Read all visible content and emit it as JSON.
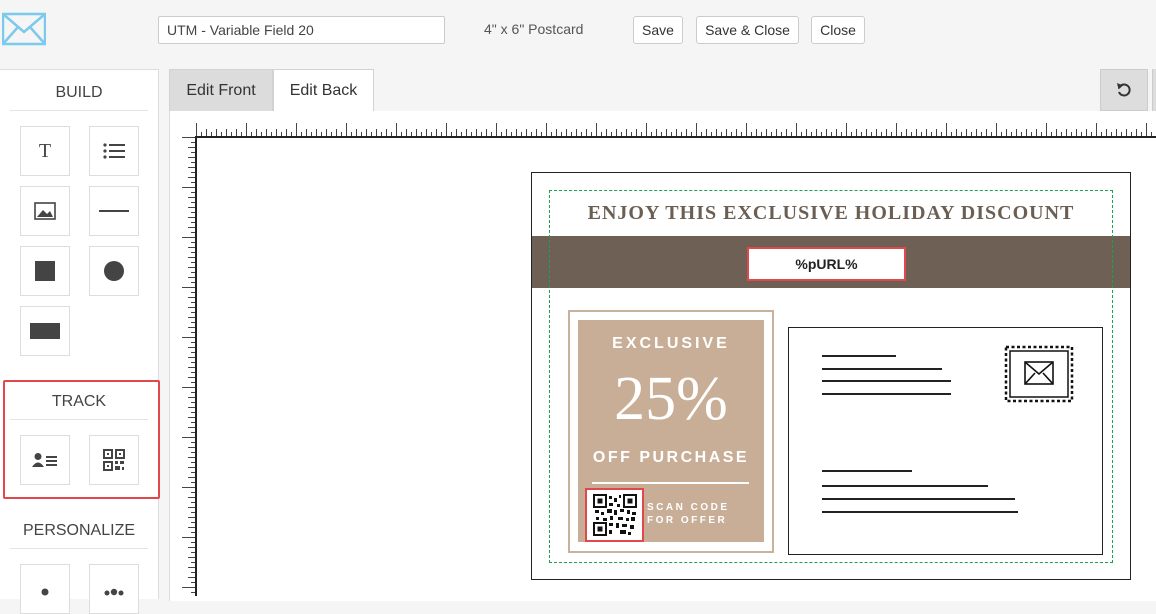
{
  "header": {
    "campaign_name": "UTM - Variable Field 20",
    "size_label": "4\" x 6\" Postcard",
    "save_label": "Save",
    "save_close_label": "Save & Close",
    "close_label": "Close",
    "logo_icon": "envelope-logo-icon"
  },
  "sidebar": {
    "build_title": "BUILD",
    "track_title": "TRACK",
    "personalize_title": "PERSONALIZE",
    "build_tools": [
      "text-tool-icon",
      "list-tool-icon",
      "image-tool-icon",
      "line-tool-icon",
      "square-tool-icon",
      "circle-tool-icon",
      "rectangle-tool-icon"
    ],
    "track_tools": [
      "contact-card-icon",
      "qr-code-icon"
    ],
    "personalize_tools": [
      "person-icon",
      "group-icon"
    ],
    "text_tool_glyph": "T"
  },
  "tabs": [
    {
      "label": "Edit Front",
      "active": false
    },
    {
      "label": "Edit Back",
      "active": true
    }
  ],
  "postcard": {
    "heading": "ENJOY THIS EXCLUSIVE HOLIDAY DISCOUNT",
    "purl": "%pURL%",
    "offer": {
      "exclusive": "EXCLUSIVE",
      "percent": "25%",
      "off": "OFF PURCHASE",
      "scan_line1": "SCAN CODE",
      "scan_line2": "FOR OFFER"
    }
  },
  "colors": {
    "accent_red": "#e0484b",
    "band_brown": "#6e6054",
    "offer_tan": "#c9ae97",
    "safe_zone_green": "#1aa34a"
  }
}
